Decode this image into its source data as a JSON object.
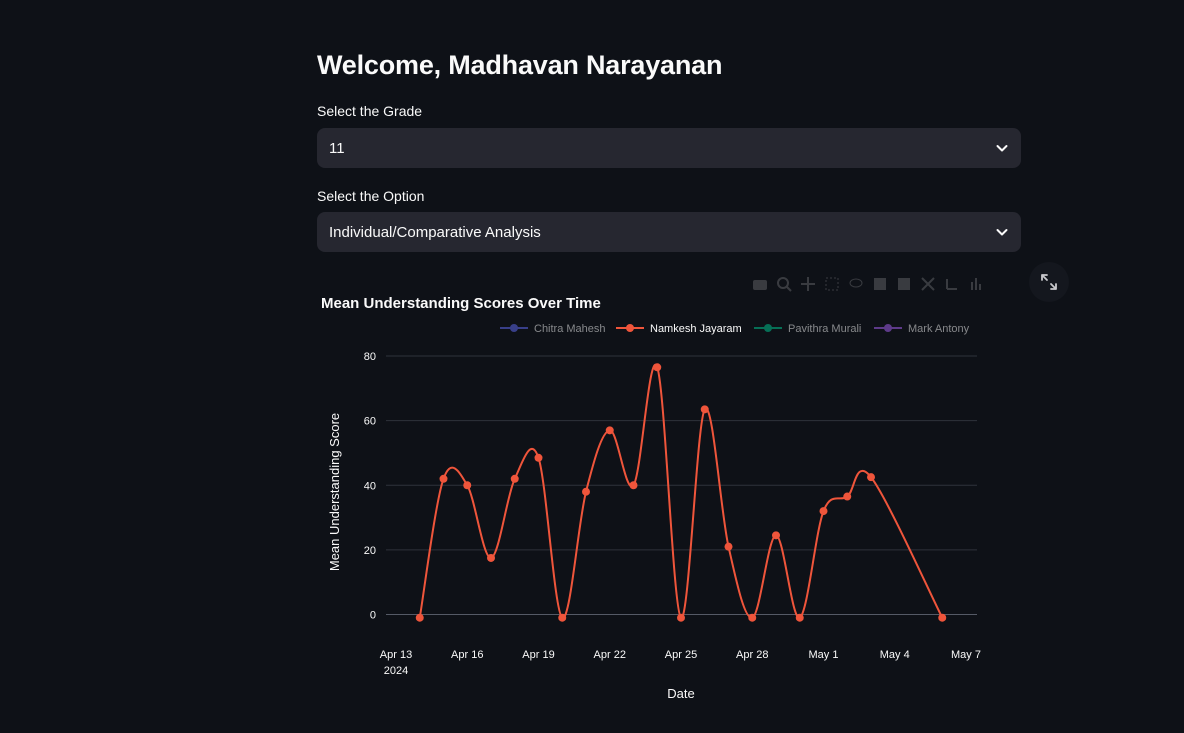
{
  "header": {
    "title": "Welcome, Madhavan Narayanan"
  },
  "grade_select": {
    "label": "Select the Grade",
    "value": "11"
  },
  "option_select": {
    "label": "Select the Option",
    "value": "Individual/Comparative Analysis"
  },
  "chart_toolbar": {
    "icons": [
      "camera-icon",
      "zoom-icon",
      "pan-icon",
      "box-select-icon",
      "lasso-icon",
      "zoom-in-icon",
      "zoom-out-icon",
      "autoscale-icon",
      "reset-axes-icon",
      "spike-lines-icon"
    ],
    "fullscreen_icon": "expand-icon"
  },
  "chart_data": {
    "type": "line",
    "title": "Mean Understanding Scores Over Time",
    "xlabel": "Date",
    "ylabel": "Mean Understanding Score",
    "ylim": [
      -3,
      82
    ],
    "yticks": [
      0,
      20,
      40,
      60,
      80
    ],
    "xticks": [
      {
        "date": "2024-04-13",
        "label": "Apr 13",
        "sublabel": "2024"
      },
      {
        "date": "2024-04-16",
        "label": "Apr 16"
      },
      {
        "date": "2024-04-19",
        "label": "Apr 19"
      },
      {
        "date": "2024-04-22",
        "label": "Apr 22"
      },
      {
        "date": "2024-04-25",
        "label": "Apr 25"
      },
      {
        "date": "2024-04-28",
        "label": "Apr 28"
      },
      {
        "date": "2024-05-01",
        "label": "May 1"
      },
      {
        "date": "2024-05-04",
        "label": "May 4"
      },
      {
        "date": "2024-05-07",
        "label": "May 7"
      }
    ],
    "xlim": [
      "2024-04-13",
      "2024-05-07"
    ],
    "grid": true,
    "legend": "top",
    "series": [
      {
        "name": "Chitra Mahesh",
        "color": "#636efa",
        "visible": false,
        "points": []
      },
      {
        "name": "Namkesh Jayaram",
        "color": "#ef553b",
        "visible": true,
        "points": [
          {
            "x": "2024-04-14",
            "y": -1
          },
          {
            "x": "2024-04-15",
            "y": 42
          },
          {
            "x": "2024-04-16",
            "y": 40
          },
          {
            "x": "2024-04-17",
            "y": 17.5
          },
          {
            "x": "2024-04-18",
            "y": 42
          },
          {
            "x": "2024-04-19",
            "y": 48.5
          },
          {
            "x": "2024-04-20",
            "y": -1
          },
          {
            "x": "2024-04-21",
            "y": 38
          },
          {
            "x": "2024-04-22",
            "y": 57
          },
          {
            "x": "2024-04-23",
            "y": 40
          },
          {
            "x": "2024-04-24",
            "y": 76.5
          },
          {
            "x": "2024-04-25",
            "y": -1
          },
          {
            "x": "2024-04-26",
            "y": 63.5
          },
          {
            "x": "2024-04-27",
            "y": 21
          },
          {
            "x": "2024-04-28",
            "y": -1
          },
          {
            "x": "2024-04-29",
            "y": 24.5
          },
          {
            "x": "2024-04-30",
            "y": -1
          },
          {
            "x": "2024-05-01",
            "y": 32
          },
          {
            "x": "2024-05-02",
            "y": 36.5
          },
          {
            "x": "2024-05-03",
            "y": 42.5
          },
          {
            "x": "2024-05-06",
            "y": -1
          }
        ]
      },
      {
        "name": "Pavithra Murali",
        "color": "#00cc96",
        "visible": false,
        "points": []
      },
      {
        "name": "Mark Antony",
        "color": "#ab63fa",
        "visible": false,
        "points": []
      }
    ]
  }
}
